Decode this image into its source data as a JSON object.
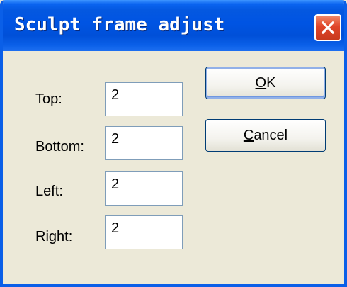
{
  "window": {
    "title": "Sculpt frame adjust",
    "colors": {
      "titlebar": "#0054e3",
      "body": "#ece9d8",
      "close": "#e0452a"
    }
  },
  "fields": [
    {
      "label": "Top:",
      "value": "2"
    },
    {
      "label": "Bottom:",
      "value": "2"
    },
    {
      "label": "Left:",
      "value": "2"
    },
    {
      "label": "Right:",
      "value": "2"
    }
  ],
  "buttons": {
    "ok": {
      "mnemonic": "O",
      "rest": "K"
    },
    "cancel": {
      "mnemonic": "C",
      "rest": "ancel"
    }
  },
  "icons": {
    "close": "close-icon"
  }
}
